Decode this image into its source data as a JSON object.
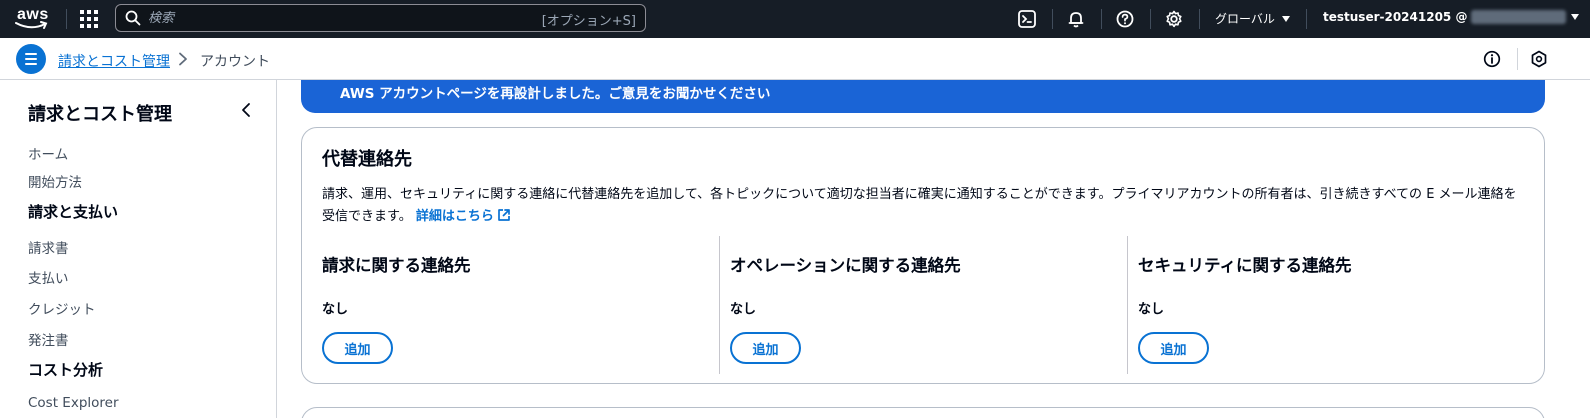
{
  "topbar": {
    "logo_text": "aws",
    "search_placeholder": "検索",
    "search_shortcut": "[オプション+S]",
    "region_label": "グローバル",
    "user_label": "testuser-20241205 @"
  },
  "breadcrumb": {
    "parent": "請求とコスト管理",
    "current": "アカウント"
  },
  "sidenav": {
    "title": "請求とコスト管理",
    "items": [
      {
        "label": "ホーム",
        "type": "item"
      },
      {
        "label": "開始方法",
        "type": "item"
      },
      {
        "label": "請求と支払い",
        "type": "section"
      },
      {
        "label": "請求書",
        "type": "item"
      },
      {
        "label": "支払い",
        "type": "item"
      },
      {
        "label": "クレジット",
        "type": "item"
      },
      {
        "label": "発注書",
        "type": "item"
      },
      {
        "label": "コスト分析",
        "type": "section"
      },
      {
        "label": "Cost Explorer",
        "type": "item"
      }
    ]
  },
  "banner": {
    "text": "AWS アカウントページを再設計しました。ご意見をお聞かせください"
  },
  "alternate_contacts": {
    "title": "代替連絡先",
    "description": "請求、運用、セキュリティに関する連絡に代替連絡先を追加して、各トピックについて適切な担当者に確実に通知することができます。プライマリアカウントの所有者は、引き続きすべての E メール連絡を受信できます。",
    "learn_more": "詳細はこちら",
    "columns": [
      {
        "title": "請求に関する連絡先",
        "value": "なし",
        "button": "追加"
      },
      {
        "title": "オペレーションに関する連絡先",
        "value": "なし",
        "button": "追加"
      },
      {
        "title": "セキュリティに関する連絡先",
        "value": "なし",
        "button": "追加"
      }
    ]
  },
  "colors": {
    "topbar_bg": "#161d26",
    "accent": "#0972d3",
    "banner_bg": "#1a64d6"
  }
}
